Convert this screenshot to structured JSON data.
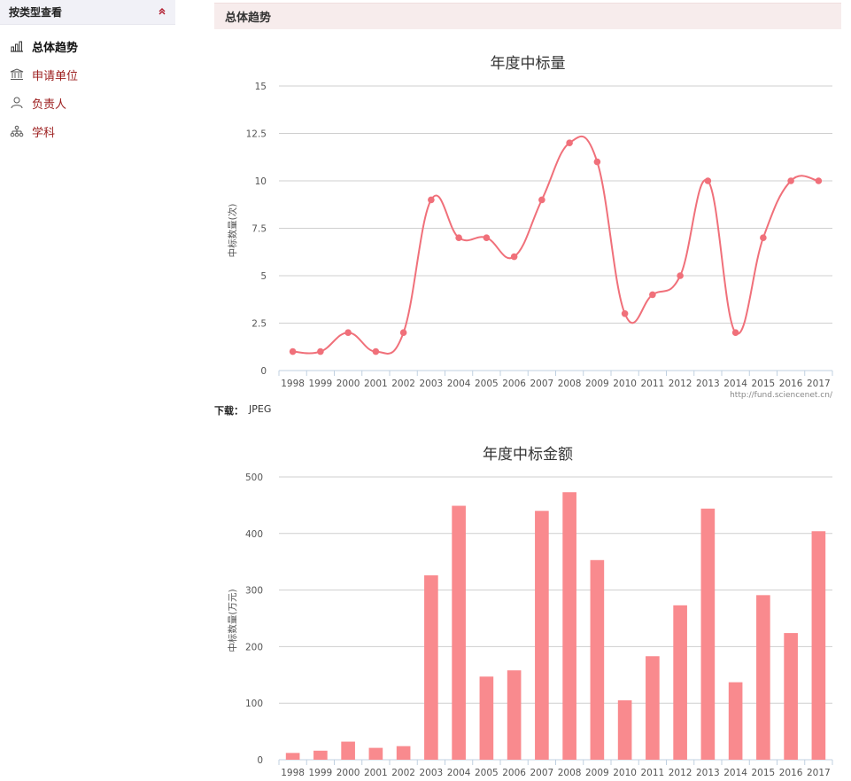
{
  "sidebar": {
    "title": "按类型查看",
    "items": [
      {
        "label": "总体趋势",
        "icon": "bar-chart-icon"
      },
      {
        "label": "申请单位",
        "icon": "institution-icon"
      },
      {
        "label": "负责人",
        "icon": "person-icon"
      },
      {
        "label": "学科",
        "icon": "hierarchy-icon"
      }
    ]
  },
  "main": {
    "section_title": "总体趋势",
    "download": {
      "label": "下载：",
      "format": "JPEG"
    },
    "credit": "http://fund.sciencenet.cn/"
  },
  "colors": {
    "line": "#f0707a",
    "bar": "#f98a8e",
    "accent": "#9b1b1b"
  },
  "chart_data": [
    {
      "type": "line",
      "title": "年度中标量",
      "ylabel": "中标数量(次)",
      "categories": [
        "1998",
        "1999",
        "2000",
        "2001",
        "2002",
        "2003",
        "2004",
        "2005",
        "2006",
        "2007",
        "2008",
        "2009",
        "2010",
        "2011",
        "2012",
        "2013",
        "2014",
        "2015",
        "2016",
        "2017"
      ],
      "values": [
        1,
        1,
        2,
        1,
        2,
        9,
        7,
        7,
        6,
        9,
        12,
        11,
        3,
        4,
        5,
        10,
        2,
        7,
        10,
        10
      ],
      "ylim": [
        0,
        15
      ],
      "yticks": [
        "0",
        "2.5",
        "5",
        "7.5",
        "10",
        "12.5",
        "15"
      ],
      "grid": true
    },
    {
      "type": "bar",
      "title": "年度中标金额",
      "ylabel": "中标数量(万元)",
      "categories": [
        "1998",
        "1999",
        "2000",
        "2001",
        "2002",
        "2003",
        "2004",
        "2005",
        "2006",
        "2007",
        "2008",
        "2009",
        "2010",
        "2011",
        "2012",
        "2013",
        "2014",
        "2015",
        "2016",
        "2017"
      ],
      "values": [
        12,
        16,
        32,
        21,
        24,
        326,
        449,
        147,
        158,
        440,
        473,
        353,
        105,
        183,
        273,
        444,
        137,
        291,
        224,
        404
      ],
      "ylim": [
        0,
        500
      ],
      "yticks": [
        "0",
        "100",
        "200",
        "300",
        "400",
        "500"
      ],
      "grid": true
    }
  ]
}
